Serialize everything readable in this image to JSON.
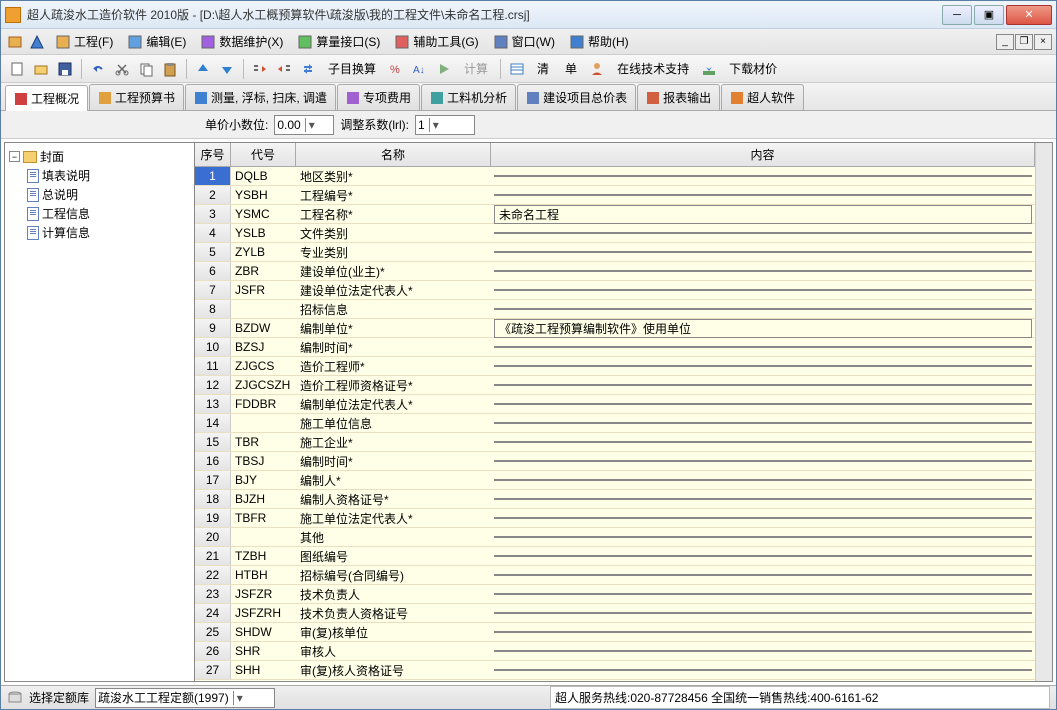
{
  "title": "超人疏浚水工造价软件 2010版 - [D:\\超人水工概预算软件\\疏浚版\\我的工程文件\\未命名工程.crsj]",
  "menu": {
    "items": [
      {
        "label": "工程(F)",
        "icon": "project"
      },
      {
        "label": "编辑(E)",
        "icon": "edit"
      },
      {
        "label": "数据维护(X)",
        "icon": "data"
      },
      {
        "label": "算量接口(S)",
        "icon": "calc"
      },
      {
        "label": "辅助工具(G)",
        "icon": "tools"
      },
      {
        "label": "窗口(W)",
        "icon": "window"
      },
      {
        "label": "帮助(H)",
        "icon": "help"
      }
    ]
  },
  "toolbar": {
    "subitem_btn": "子目换算",
    "calc_btn": "计算",
    "qing_btn": "清",
    "dan_btn": "单",
    "support_btn": "在线技术支持",
    "download_btn": "下载材价"
  },
  "tabs": [
    {
      "label": "工程概况",
      "icon": "overview"
    },
    {
      "label": "工程预算书",
      "icon": "budget"
    },
    {
      "label": "测量, 浮标, 扫床, 调遣",
      "icon": "measure"
    },
    {
      "label": "专项费用",
      "icon": "special"
    },
    {
      "label": "工料机分析",
      "icon": "analysis"
    },
    {
      "label": "建设项目总价表",
      "icon": "total"
    },
    {
      "label": "报表输出",
      "icon": "report"
    },
    {
      "label": "超人软件",
      "icon": "app"
    }
  ],
  "subbar": {
    "decimal_label": "单价小数位:",
    "decimal_value": "0.00",
    "adjust_label": "调整系数(lrl):",
    "adjust_value": "1"
  },
  "tree": {
    "root": "封面",
    "children": [
      "填表说明",
      "总说明",
      "工程信息",
      "计算信息"
    ]
  },
  "grid": {
    "headers": {
      "seq": "序号",
      "code": "代号",
      "name": "名称",
      "content": "内容"
    },
    "rows": [
      {
        "seq": "1",
        "code": "DQLB",
        "name": "地区类别*",
        "content": ""
      },
      {
        "seq": "2",
        "code": "YSBH",
        "name": "工程编号*",
        "content": ""
      },
      {
        "seq": "3",
        "code": "YSMC",
        "name": "工程名称*",
        "content": "未命名工程"
      },
      {
        "seq": "4",
        "code": "YSLB",
        "name": "文件类别",
        "content": ""
      },
      {
        "seq": "5",
        "code": "ZYLB",
        "name": "专业类别",
        "content": ""
      },
      {
        "seq": "6",
        "code": "ZBR",
        "name": "建设单位(业主)*",
        "content": ""
      },
      {
        "seq": "7",
        "code": "JSFR",
        "name": "建设单位法定代表人*",
        "content": ""
      },
      {
        "seq": "8",
        "code": "",
        "name": "招标信息",
        "content": ""
      },
      {
        "seq": "9",
        "code": "BZDW",
        "name": "编制单位*",
        "content": "《疏浚工程预算编制软件》使用单位"
      },
      {
        "seq": "10",
        "code": "BZSJ",
        "name": "编制时间*",
        "content": ""
      },
      {
        "seq": "11",
        "code": "ZJGCS",
        "name": "造价工程师*",
        "content": ""
      },
      {
        "seq": "12",
        "code": "ZJGCSZH",
        "name": "造价工程师资格证号*",
        "content": ""
      },
      {
        "seq": "13",
        "code": "FDDBR",
        "name": "编制单位法定代表人*",
        "content": ""
      },
      {
        "seq": "14",
        "code": "",
        "name": "施工单位信息",
        "content": ""
      },
      {
        "seq": "15",
        "code": "TBR",
        "name": "施工企业*",
        "content": ""
      },
      {
        "seq": "16",
        "code": "TBSJ",
        "name": "编制时间*",
        "content": ""
      },
      {
        "seq": "17",
        "code": "BJY",
        "name": "编制人*",
        "content": ""
      },
      {
        "seq": "18",
        "code": "BJZH",
        "name": "编制人资格证号*",
        "content": ""
      },
      {
        "seq": "19",
        "code": "TBFR",
        "name": "施工单位法定代表人*",
        "content": ""
      },
      {
        "seq": "20",
        "code": "",
        "name": "其他",
        "content": ""
      },
      {
        "seq": "21",
        "code": "TZBH",
        "name": "图纸编号",
        "content": ""
      },
      {
        "seq": "22",
        "code": "HTBH",
        "name": "招标编号(合同编号)",
        "content": ""
      },
      {
        "seq": "23",
        "code": "JSFZR",
        "name": "技术负责人",
        "content": ""
      },
      {
        "seq": "24",
        "code": "JSFZRH",
        "name": "技术负责人资格证号",
        "content": ""
      },
      {
        "seq": "25",
        "code": "SHDW",
        "name": "审(复)核单位",
        "content": ""
      },
      {
        "seq": "26",
        "code": "SHR",
        "name": "审核人",
        "content": ""
      },
      {
        "seq": "27",
        "code": "SHH",
        "name": "审(复)核人资格证号",
        "content": ""
      }
    ]
  },
  "status": {
    "quota_label": "选择定额库",
    "quota_value": "疏浚水工工程定额(1997)",
    "hotline": "超人服务热线:020-87728456 全国统一销售热线:400-6161-62"
  }
}
